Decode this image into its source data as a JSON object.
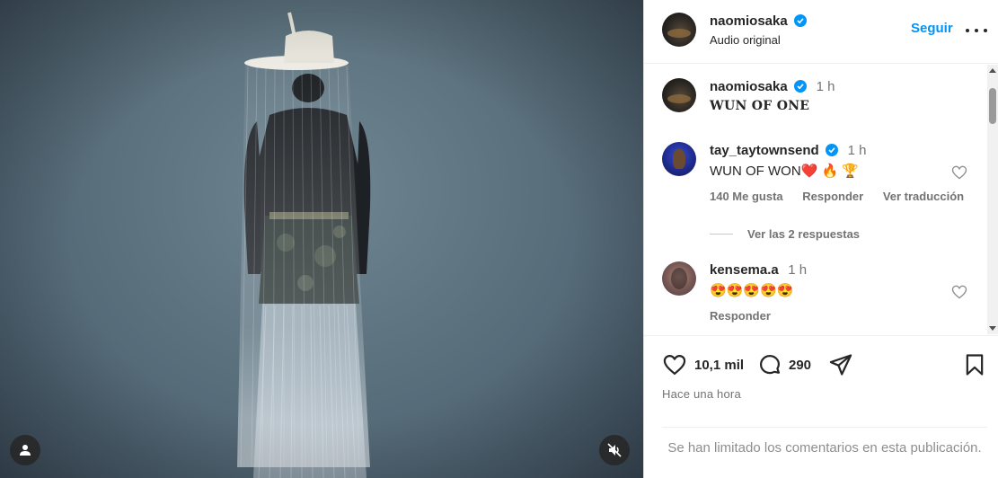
{
  "post": {
    "author": {
      "username": "naomiosaka",
      "subtitle": "Audio original",
      "follow_label": "Seguir"
    },
    "caption": {
      "username": "naomiosaka",
      "time": "1 h",
      "text": "WUN OF ONE"
    },
    "comments": [
      {
        "username": "tay_taytownsend",
        "time": "1 h",
        "text": "WUN OF WON",
        "emojis": "❤️ 🔥 🏆",
        "likes_label": "140 Me gusta",
        "reply_label": "Responder",
        "translate_label": "Ver traducción",
        "view_replies_label": "Ver las 2 respuestas"
      },
      {
        "username": "kensema.a",
        "time": "1 h",
        "emojis": "😍😍😍😍😍",
        "reply_label": "Responder"
      }
    ],
    "stats": {
      "likes": "10,1 mil",
      "comments": "290"
    },
    "posted_when": "Hace una hora",
    "comments_limited_notice": "Se han limitado los comentarios en esta publicación."
  },
  "icons": {
    "verified": "verified-badge-icon",
    "like": "heart-icon",
    "comment": "comment-icon",
    "share": "share-icon",
    "save": "bookmark-icon",
    "more": "more-options-icon",
    "mute": "speaker-muted-icon",
    "tagged": "user-tag-icon"
  },
  "colors": {
    "accent": "#0095f6",
    "verified": "#0095f6",
    "secondary_text": "#737373"
  }
}
